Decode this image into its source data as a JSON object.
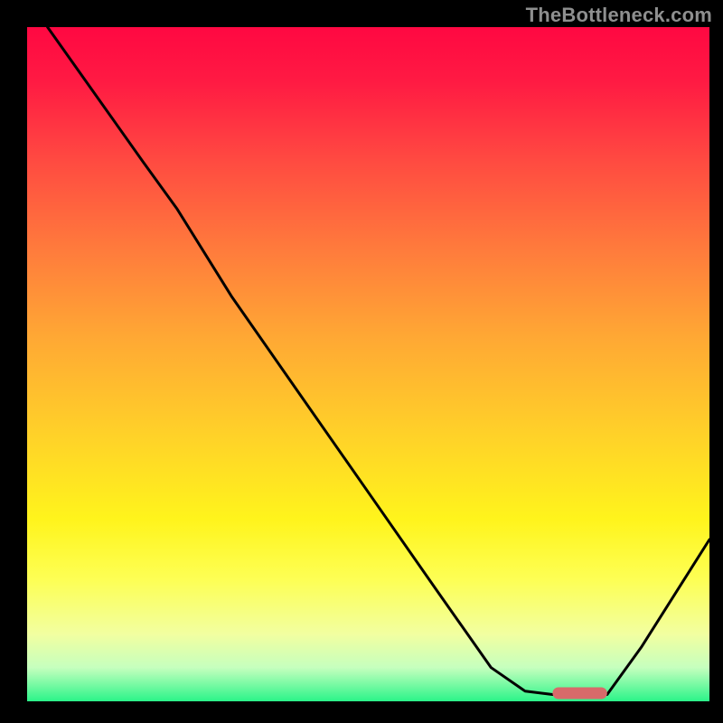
{
  "watermark": "TheBottleneck.com",
  "colors": {
    "gradient_top": "#ff0842",
    "gradient_mid": "#ffd029",
    "gradient_bottom": "#2bf489",
    "curve": "#000000",
    "marker": "#d86a6a",
    "frame": "#000000"
  },
  "chart_data": {
    "type": "line",
    "title": "",
    "xlabel": "",
    "ylabel": "",
    "xlim": [
      0,
      100
    ],
    "ylim": [
      0,
      100
    ],
    "marker_x_range": [
      77,
      85
    ],
    "marker_y": 1.2,
    "series": [
      {
        "name": "bottleneck-curve",
        "x": [
          3,
          10,
          17,
          22,
          30,
          40,
          50,
          60,
          68,
          73,
          77,
          81,
          85,
          90,
          95,
          100
        ],
        "y": [
          100,
          90,
          80,
          73,
          60,
          45.5,
          31,
          16.5,
          5,
          1.5,
          1,
          1,
          1,
          8,
          16,
          24
        ]
      }
    ]
  }
}
